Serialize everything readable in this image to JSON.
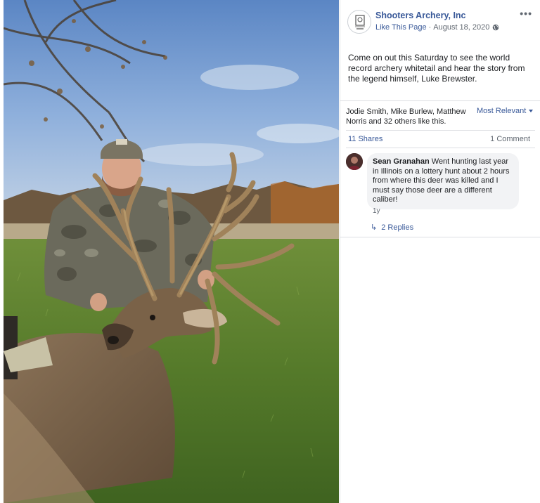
{
  "post": {
    "page_name": "Shooters Archery, Inc",
    "like_page": "Like This Page",
    "separator": "·",
    "date": "August 18, 2020",
    "visibility_icon": "globe-icon",
    "more_icon": "more-options-icon",
    "more_label": "•••",
    "text": "Come on out this Saturday to see the world record archery whitetail and hear the story from the legend himself, Luke Brewster."
  },
  "reactions": {
    "likes_text": "Jodie Smith, Mike Burlew, Matthew Norris and 32 others like this.",
    "sort_label": "Most Relevant",
    "shares": "11 Shares",
    "comments": "1 Comment"
  },
  "comment": {
    "author": "Sean Granahan",
    "text": " Went hunting last year in Illinois on a lottery hunt about 2 hours from where this deer was killed and I must say those deer are a different caliber!",
    "time": "1y",
    "replies": "2 Replies",
    "reply_icon": "reply-arrow-icon"
  },
  "photo": {
    "description_icon": "hunter-with-deer-photo"
  },
  "colors": {
    "link": "#385898",
    "secondary_text": "#606770",
    "bubble": "#f2f3f5"
  }
}
